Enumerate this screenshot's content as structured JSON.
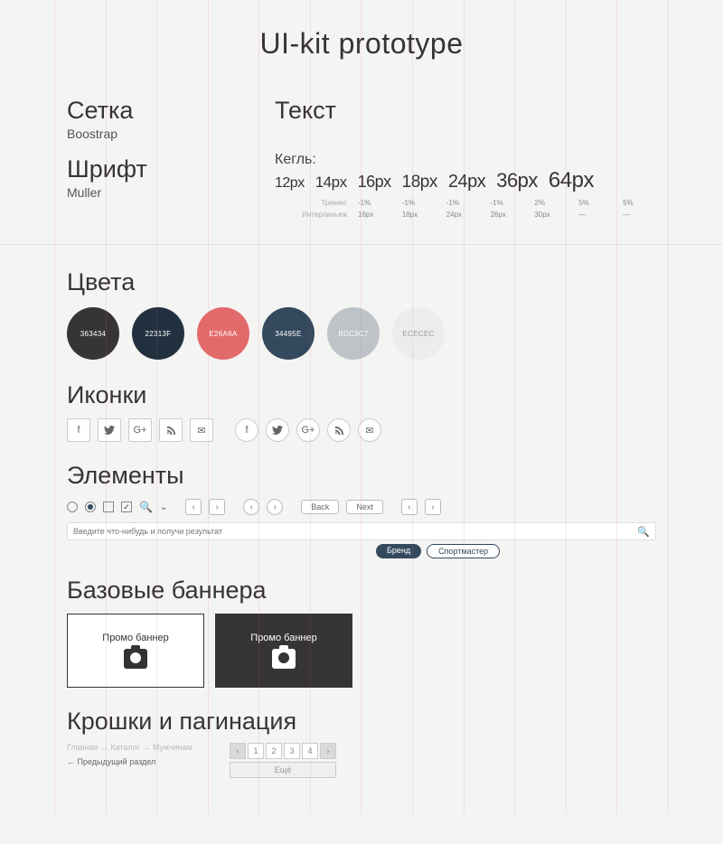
{
  "title": "UI-kit prototype",
  "grid": {
    "heading": "Сетка",
    "sub": "Boostrap"
  },
  "font": {
    "heading": "Шрифт",
    "sub": "Muller"
  },
  "text": {
    "heading": "Текст",
    "kegl_label": "Кегль:",
    "sizes": [
      "12px",
      "14px",
      "16px",
      "18px",
      "24px",
      "36px",
      "64px"
    ],
    "tracking_label": "Трекинг",
    "leading_label": "Интерлиньяж",
    "tracking": [
      "-1%",
      "-1%",
      "-1%",
      "-1%",
      "2%",
      "5%",
      "5%"
    ],
    "leading": [
      "16px",
      "18px",
      "24px",
      "26px",
      "30px",
      "—",
      "—"
    ]
  },
  "colors": {
    "heading": "Цвета",
    "swatches": [
      {
        "hex": "363434",
        "label": "363434"
      },
      {
        "hex": "22313F",
        "label": "22313F"
      },
      {
        "hex": "E26A6A",
        "label": "E26A6A"
      },
      {
        "hex": "34495E",
        "label": "34495E"
      },
      {
        "hex": "BDC3C7",
        "label": "BDC3C7"
      },
      {
        "hex": "ECECEC",
        "label": "ECECEC",
        "light": true
      }
    ]
  },
  "icons": {
    "heading": "Иконки"
  },
  "elements": {
    "heading": "Элементы",
    "back": "Back",
    "next": "Next",
    "search_placeholder": "Введите что-нибудь и получи результат",
    "tag_filled": "Бренд",
    "tag_outline": "Спортмастер"
  },
  "banners": {
    "heading": "Базовые баннера",
    "label": "Промо баннер"
  },
  "crumbs": {
    "heading": "Крошки и пагинация",
    "path": "Главная → Каталог → Мужчинам",
    "back": "← Предыдущий раздел",
    "pages": [
      "1",
      "2",
      "3",
      "4"
    ],
    "more": "Ещё"
  }
}
